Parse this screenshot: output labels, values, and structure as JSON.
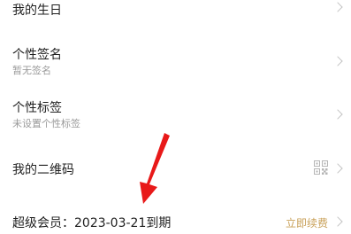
{
  "rows": {
    "birthday": {
      "title": "我的生日"
    },
    "signature": {
      "title": "个性签名",
      "value": "暂无签名"
    },
    "tags": {
      "title": "个性标签",
      "value": "未设置个性标签"
    },
    "qrcode": {
      "title": "我的二维码"
    },
    "vip": {
      "title": "超级会员：2023-03-21到期",
      "action": "立即续费"
    }
  },
  "colors": {
    "text": "#1f1f1f",
    "subtext": "#9a9a9a",
    "chevron": "#c4c4c4",
    "accent_gold": "#c9a15a",
    "annotation_red": "#e81919"
  },
  "icons": {
    "chevron": "chevron-right-icon",
    "qr": "qr-code-icon",
    "annotation": "red-arrow-annotation"
  }
}
